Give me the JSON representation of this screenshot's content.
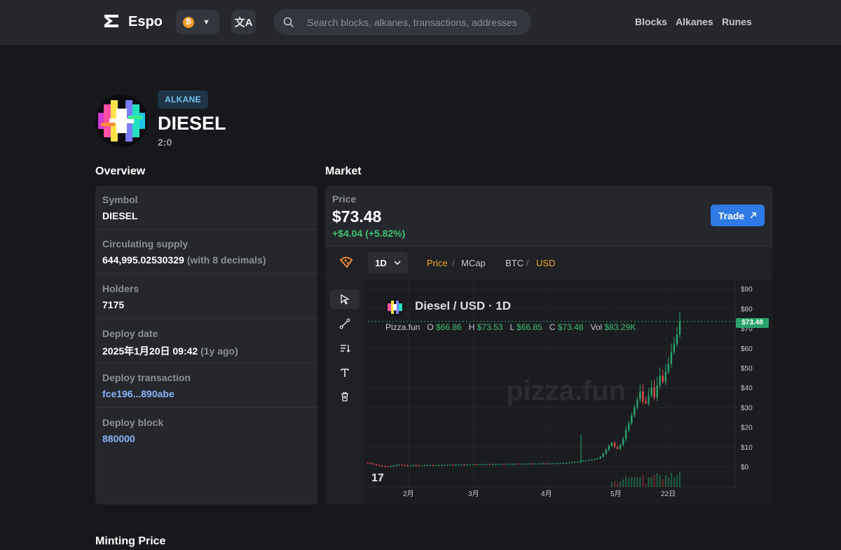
{
  "header": {
    "app_name": "Espo",
    "network_icon": "bitcoin-icon",
    "search_placeholder": "Search blocks, alkanes, transactions, addresses",
    "nav": [
      "Blocks",
      "Alkanes",
      "Runes"
    ]
  },
  "token": {
    "badge": "ALKANE",
    "name": "DIESEL",
    "id": "2:0"
  },
  "sections": {
    "overview": "Overview",
    "market": "Market",
    "minting": "Minting Price"
  },
  "overview": {
    "rows": [
      {
        "label": "Symbol",
        "value": "DIESEL",
        "extra": ""
      },
      {
        "label": "Circulating supply",
        "value": "644,995.02530329",
        "extra": "(with 8 decimals)"
      },
      {
        "label": "Holders",
        "value": "7175",
        "extra": ""
      },
      {
        "label": "Deploy date",
        "value": "2025年1月20日 09:42",
        "extra": "(1y ago)"
      },
      {
        "label": "Deploy transaction",
        "value": "fce196...890abe",
        "extra": ""
      },
      {
        "label": "Deploy block",
        "value": "880000",
        "extra": ""
      }
    ]
  },
  "market": {
    "price_label": "Price",
    "price": "$73.48",
    "change": "+$4.04 (+5.82%)",
    "trade_label": "Trade",
    "timeframe": "1D",
    "toggle_metric": [
      "Price",
      "MCap"
    ],
    "toggle_currency": [
      "BTC",
      "USD"
    ],
    "active_metric": "Price",
    "active_currency": "USD"
  },
  "chart_data": {
    "type": "candlestick",
    "title": "Diesel / USD · 1D",
    "source": "Pizza.fun",
    "ohlc": {
      "O": "$66.86",
      "H": "$73.53",
      "L": "$66.85",
      "C": "$73.48",
      "Vol": "$83.29K"
    },
    "last_price_label": "$73.48",
    "ylim": [
      -5,
      95
    ],
    "y_ticks": [
      "$90",
      "$80",
      "$70",
      "$60",
      "$50",
      "$40",
      "$30",
      "$20",
      "$10",
      "$0"
    ],
    "x_ticks": [
      "2月",
      "3月",
      "4月",
      "5月",
      "22日"
    ],
    "watermark": "pizza.fun",
    "closes_approx": [
      1.8,
      1.5,
      1.2,
      0.8,
      0.5,
      0.3,
      0.1,
      -0.1,
      0.2,
      0.5,
      0.7,
      0.9,
      0.8,
      0.6,
      0.4,
      0.5,
      0.7,
      0.6,
      0.5,
      0.5,
      0.6,
      0.7,
      0.7,
      0.6,
      0.6,
      0.7,
      0.8,
      0.8,
      0.9,
      0.9,
      0.8,
      0.9,
      1.0,
      1.0,
      0.9,
      1.0,
      1.0,
      1.1,
      1.0,
      1.1,
      1.1,
      1.1,
      1.2,
      1.1,
      1.2,
      1.2,
      1.2,
      1.3,
      1.2,
      1.3,
      1.3,
      1.3,
      1.4,
      1.3,
      1.4,
      1.4,
      1.4,
      1.5,
      1.4,
      1.5,
      1.5,
      1.5,
      1.6,
      1.5,
      1.6,
      1.6,
      1.6,
      1.7,
      1.7,
      1.8,
      1.9,
      2.0,
      2.2,
      2.4,
      2.5,
      2.8,
      3.0,
      3.2,
      3.4,
      3.6,
      3.8,
      4.2,
      5.0,
      6.5,
      8.5,
      10.5,
      12.0,
      10.0,
      9.0,
      11.0,
      14.0,
      18.5,
      22.0,
      26.0,
      30.0,
      34.0,
      38.0,
      33.0,
      32.0,
      36.0,
      40.0,
      35.0,
      41.0,
      46.0,
      43.0,
      48.0,
      52.0,
      58.0,
      62.0,
      66.86,
      73.48
    ]
  }
}
